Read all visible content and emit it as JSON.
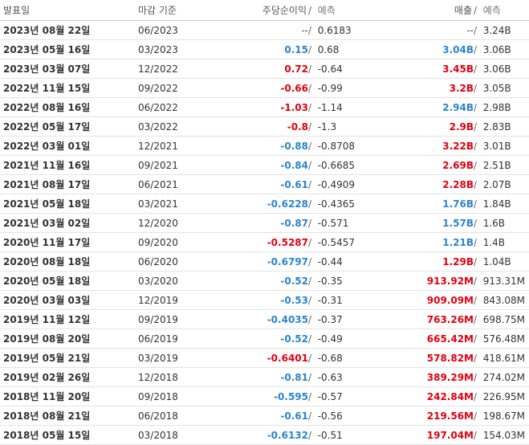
{
  "headers": {
    "release_date": "발표일",
    "period_end": "마감 기준",
    "eps": "주당순이익",
    "eps_forecast": "예측",
    "revenue": "매출",
    "revenue_forecast": "예측",
    "separator": "/"
  },
  "colors": {
    "positive": "#2a85cd",
    "negative": "#e3000f",
    "neutral": "#555555"
  },
  "rows": [
    {
      "date": "2023년 08월 22일",
      "period": "06/2023",
      "eps": "--",
      "eps_class": "na",
      "eps_forecast": "0.6183",
      "revenue": "--",
      "rev_class": "na",
      "rev_forecast": "3.24B"
    },
    {
      "date": "2023년 05월 16일",
      "period": "03/2023",
      "eps": "0.15",
      "eps_class": "pos",
      "eps_forecast": "0.68",
      "revenue": "3.04B",
      "rev_class": "pos",
      "rev_forecast": "3.06B"
    },
    {
      "date": "2023년 03월 07일",
      "period": "12/2022",
      "eps": "0.72",
      "eps_class": "neg",
      "eps_forecast": "-0.64",
      "revenue": "3.45B",
      "rev_class": "neg",
      "rev_forecast": "3.06B"
    },
    {
      "date": "2022년 11월 15일",
      "period": "09/2022",
      "eps": "-0.66",
      "eps_class": "neg",
      "eps_forecast": "-0.99",
      "revenue": "3.2B",
      "rev_class": "neg",
      "rev_forecast": "3.05B"
    },
    {
      "date": "2022년 08월 16일",
      "period": "06/2022",
      "eps": "-1.03",
      "eps_class": "neg",
      "eps_forecast": "-1.14",
      "revenue": "2.94B",
      "rev_class": "pos",
      "rev_forecast": "2.98B"
    },
    {
      "date": "2022년 05월 17일",
      "period": "03/2022",
      "eps": "-0.8",
      "eps_class": "neg",
      "eps_forecast": "-1.3",
      "revenue": "2.9B",
      "rev_class": "neg",
      "rev_forecast": "2.83B"
    },
    {
      "date": "2022년 03월 01일",
      "period": "12/2021",
      "eps": "-0.88",
      "eps_class": "pos",
      "eps_forecast": "-0.8708",
      "revenue": "3.22B",
      "rev_class": "neg",
      "rev_forecast": "3.01B"
    },
    {
      "date": "2021년 11월 16일",
      "period": "09/2021",
      "eps": "-0.84",
      "eps_class": "pos",
      "eps_forecast": "-0.6685",
      "revenue": "2.69B",
      "rev_class": "neg",
      "rev_forecast": "2.51B"
    },
    {
      "date": "2021년 08월 17일",
      "period": "06/2021",
      "eps": "-0.61",
      "eps_class": "pos",
      "eps_forecast": "-0.4909",
      "revenue": "2.28B",
      "rev_class": "neg",
      "rev_forecast": "2.07B"
    },
    {
      "date": "2021년 05월 18일",
      "period": "03/2021",
      "eps": "-0.6228",
      "eps_class": "pos",
      "eps_forecast": "-0.4365",
      "revenue": "1.76B",
      "rev_class": "pos",
      "rev_forecast": "1.84B"
    },
    {
      "date": "2021년 03월 02일",
      "period": "12/2020",
      "eps": "-0.87",
      "eps_class": "pos",
      "eps_forecast": "-0.571",
      "revenue": "1.57B",
      "rev_class": "pos",
      "rev_forecast": "1.6B"
    },
    {
      "date": "2020년 11월 17일",
      "period": "09/2020",
      "eps": "-0.5287",
      "eps_class": "neg",
      "eps_forecast": "-0.5457",
      "revenue": "1.21B",
      "rev_class": "pos",
      "rev_forecast": "1.4B"
    },
    {
      "date": "2020년 08월 18일",
      "period": "06/2020",
      "eps": "-0.6797",
      "eps_class": "pos",
      "eps_forecast": "-0.44",
      "revenue": "1.29B",
      "rev_class": "neg",
      "rev_forecast": "1.04B"
    },
    {
      "date": "2020년 05월 18일",
      "period": "03/2020",
      "eps": "-0.52",
      "eps_class": "pos",
      "eps_forecast": "-0.35",
      "revenue": "913.92M",
      "rev_class": "neg",
      "rev_forecast": "913.31M"
    },
    {
      "date": "2020년 03월 03일",
      "period": "12/2019",
      "eps": "-0.53",
      "eps_class": "pos",
      "eps_forecast": "-0.31",
      "revenue": "909.09M",
      "rev_class": "neg",
      "rev_forecast": "843.08M"
    },
    {
      "date": "2019년 11월 12일",
      "period": "09/2019",
      "eps": "-0.4035",
      "eps_class": "pos",
      "eps_forecast": "-0.37",
      "revenue": "763.26M",
      "rev_class": "neg",
      "rev_forecast": "698.75M"
    },
    {
      "date": "2019년 08월 20일",
      "period": "06/2019",
      "eps": "-0.52",
      "eps_class": "pos",
      "eps_forecast": "-0.49",
      "revenue": "665.42M",
      "rev_class": "neg",
      "rev_forecast": "576.48M"
    },
    {
      "date": "2019년 05월 21일",
      "period": "03/2019",
      "eps": "-0.6401",
      "eps_class": "neg",
      "eps_forecast": "-0.68",
      "revenue": "578.82M",
      "rev_class": "neg",
      "rev_forecast": "418.61M"
    },
    {
      "date": "2019년 02월 26일",
      "period": "12/2018",
      "eps": "-0.81",
      "eps_class": "pos",
      "eps_forecast": "-0.63",
      "revenue": "389.29M",
      "rev_class": "neg",
      "rev_forecast": "274.02M"
    },
    {
      "date": "2018년 11월 20일",
      "period": "09/2018",
      "eps": "-0.595",
      "eps_class": "pos",
      "eps_forecast": "-0.57",
      "revenue": "242.84M",
      "rev_class": "neg",
      "rev_forecast": "226.95M"
    },
    {
      "date": "2018년 08월 21일",
      "period": "06/2018",
      "eps": "-0.61",
      "eps_class": "pos",
      "eps_forecast": "-0.56",
      "revenue": "219.56M",
      "rev_class": "neg",
      "rev_forecast": "198.67M"
    },
    {
      "date": "2018년 05월 15일",
      "period": "03/2018",
      "eps": "-0.6132",
      "eps_class": "pos",
      "eps_forecast": "-0.51",
      "revenue": "197.04M",
      "rev_class": "neg",
      "rev_forecast": "154.03M"
    }
  ]
}
